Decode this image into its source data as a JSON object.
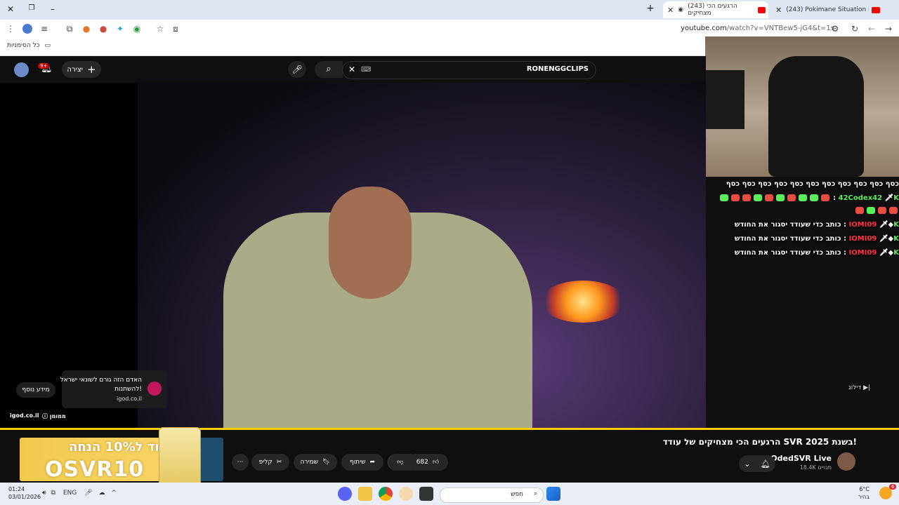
{
  "browser": {
    "tabs": [
      {
        "label": "(243) Pokimane Situation is Pat",
        "active": false
      },
      {
        "label": "(243) הרגעים הכי מצחיקים",
        "active": true
      }
    ],
    "url_host": "youtube.com",
    "url_path": "/watch?v=VNTBew5-jG4&t=1s",
    "bookmarks_label": "כל הסימניות"
  },
  "youtube": {
    "search_value": "RONENGGCLIPS",
    "create_label": "יצירה",
    "notification_count": "9+"
  },
  "ad_overlay": {
    "title": "האדם הזה גורם לשונאי ישראל להשתנות!",
    "site": "igod.co.il",
    "more_info": "מידע נוסף",
    "footer_site": "igod.co.il",
    "footer_sponsor": "ממומן",
    "skip_label": "דילוג"
  },
  "chat": {
    "lines": [
      {
        "user": "",
        "text": "כסף כסף כסף כסף כסף כסף כסף כסף כסף כסף כסף"
      },
      {
        "user": "42Codex42",
        "text": ""
      },
      {
        "user": "IOMI09",
        "text": "כותב כדי שעודד יסגור את החודש"
      },
      {
        "user": "IOMI09",
        "text": "כותב כדי שעודד יסגור את החודש"
      },
      {
        "user": "IOMI09",
        "text": "כותב כדי שעודד יסגור את החודש"
      }
    ]
  },
  "video": {
    "title": "הרגעים הכי מצחיקים של עודד SVR בשנת 2025!",
    "channel": "OdedSVR Live",
    "subscribers": "18.4K מנויים",
    "likes": "682",
    "share_label": "שיתוף",
    "save_label": "שמירה",
    "clip_label": "קליפ"
  },
  "ad_banner": {
    "line1": "קוד ל10% הנחה",
    "line2": "OSVR10"
  },
  "taskbar": {
    "time": "01:24",
    "date": "03/01/2026",
    "lang": "ENG",
    "search_placeholder": "חפש",
    "temp": "6°C",
    "weather": "בהיר",
    "weather_badge": "6"
  },
  "colors": {
    "progress": "#ffcc00",
    "chat_green": "#5cf05c",
    "chat_red": "#ff3344"
  }
}
